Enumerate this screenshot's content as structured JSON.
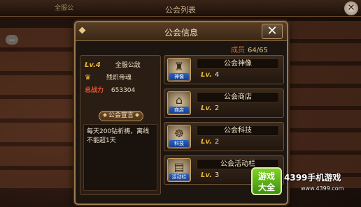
{
  "background": {
    "title": "公会列表",
    "tab": "全服公",
    "chat_icon": "...",
    "close_label": "✕"
  },
  "dialog": {
    "title": "公会信息",
    "close_label": "✕"
  },
  "members": {
    "label": "成员",
    "value": "64/65"
  },
  "guild": {
    "level": "Lv.4",
    "rank": "全服公敌",
    "leader_icon": "crown-icon",
    "leader": "残炽帝魂",
    "power_label": "总战力",
    "power": "653304"
  },
  "declaration": {
    "label": "公会宣言",
    "text": "每天200钻祈祷，离线不能超1天"
  },
  "functions": [
    {
      "name": "公会神像",
      "icon": "statue-icon",
      "tag": "神像",
      "level_prefix": "Lv.",
      "level": "4"
    },
    {
      "name": "公会商店",
      "icon": "shop-icon",
      "tag": "商店",
      "level_prefix": "Lv.",
      "level": "2"
    },
    {
      "name": "公会科技",
      "icon": "tech-icon",
      "tag": "科技",
      "level_prefix": "Lv.",
      "level": "2"
    },
    {
      "name": "公会活动栏",
      "icon": "event-board-icon",
      "tag": "活动栏",
      "level_prefix": "Lv.",
      "level": "3"
    }
  ],
  "watermark": {
    "logo_line1": "游戏",
    "logo_line2": "大全",
    "text": "4399手机游戏",
    "url": "www.4399.com"
  }
}
